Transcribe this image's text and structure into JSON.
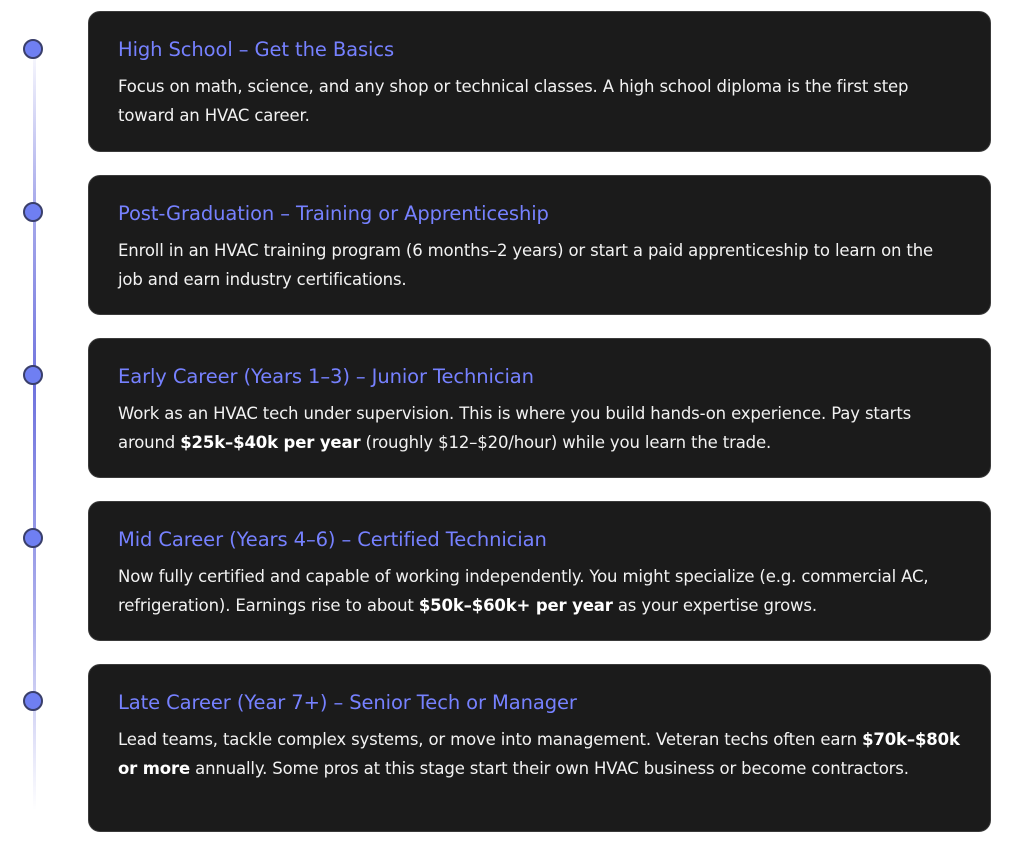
{
  "steps": [
    {
      "title": "High School – Get the Basics",
      "desc": {
        "t1": "Focus on math, science, and any shop or technical classes. A high school diploma is the first step toward an HVAC career."
      }
    },
    {
      "title": "Post-Graduation – Training or Apprenticeship",
      "desc": {
        "t1": "Enroll in an HVAC training program (6 months–2 years) or start a paid apprenticeship to learn on the job and earn industry certifications."
      }
    },
    {
      "title": "Early Career (Years 1–3) – Junior Technician",
      "desc": {
        "t1": "Work as an HVAC tech under supervision. This is where you build hands-on experience. Pay starts around ",
        "b1": "$25k–$40k per year",
        "t2": " (roughly $12–$20/hour) while you learn the trade."
      }
    },
    {
      "title": "Mid Career (Years 4–6) – Certified Technician",
      "desc": {
        "t1": "Now fully certified and capable of working independently. You might specialize (e.g. commercial AC, refrigeration). Earnings rise to about ",
        "b1": "$50k–$60k+ per year",
        "t2": " as your expertise grows."
      }
    },
    {
      "title": "Late Career (Year 7+) – Senior Tech or Manager",
      "desc": {
        "t1": "Lead teams, tackle complex systems, or move into management. Veteran techs often earn ",
        "b1": "$70k–$80k or more",
        "t2": " annually. Some pros at this stage start their own HVAC business or become contractors."
      }
    }
  ],
  "colors": {
    "accent": "#7681ff",
    "dot": "#6f7ff2",
    "card_bg": "#1b1b1b",
    "text": "#f2f2f2"
  }
}
